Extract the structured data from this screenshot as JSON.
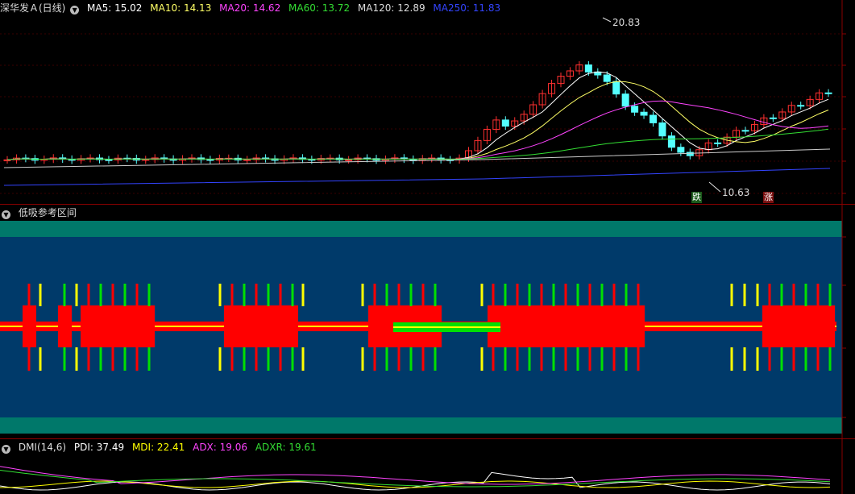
{
  "main_panel": {
    "title": "深华发Ａ(日线)",
    "indicators": [
      {
        "label": "MA5: 15.02",
        "color": "#ffffff"
      },
      {
        "label": "MA10: 14.13",
        "color": "#ffff66"
      },
      {
        "label": "MA20: 14.62",
        "color": "#ff44ff"
      },
      {
        "label": "MA60: 13.72",
        "color": "#33dd33"
      },
      {
        "label": "MA120: 12.89",
        "color": "#dddddd"
      },
      {
        "label": "MA250: 11.83",
        "color": "#3344ff"
      }
    ],
    "high_label": "20.83",
    "low_label": "10.63",
    "signal_down": "跌",
    "signal_up": "涨"
  },
  "band_panel": {
    "title": "低吸参考区间",
    "colors": {
      "outer": "#00786a",
      "inner": "#003a6a",
      "block": "#ff0000",
      "line": "#ffff00",
      "tick_green": "#00e000"
    }
  },
  "dmi_panel": {
    "title": "DMI(14,6)",
    "indicators": [
      {
        "label": "PDI: 37.49",
        "color": "#ffffff"
      },
      {
        "label": "MDI: 22.41",
        "color": "#ffff00"
      },
      {
        "label": "ADX: 19.06",
        "color": "#ff44ff"
      },
      {
        "label": "ADXR: 19.61",
        "color": "#33dd33"
      }
    ]
  },
  "colors": {
    "up": "#ff3030",
    "down": "#54ffff",
    "axis": "#8a0000"
  }
}
